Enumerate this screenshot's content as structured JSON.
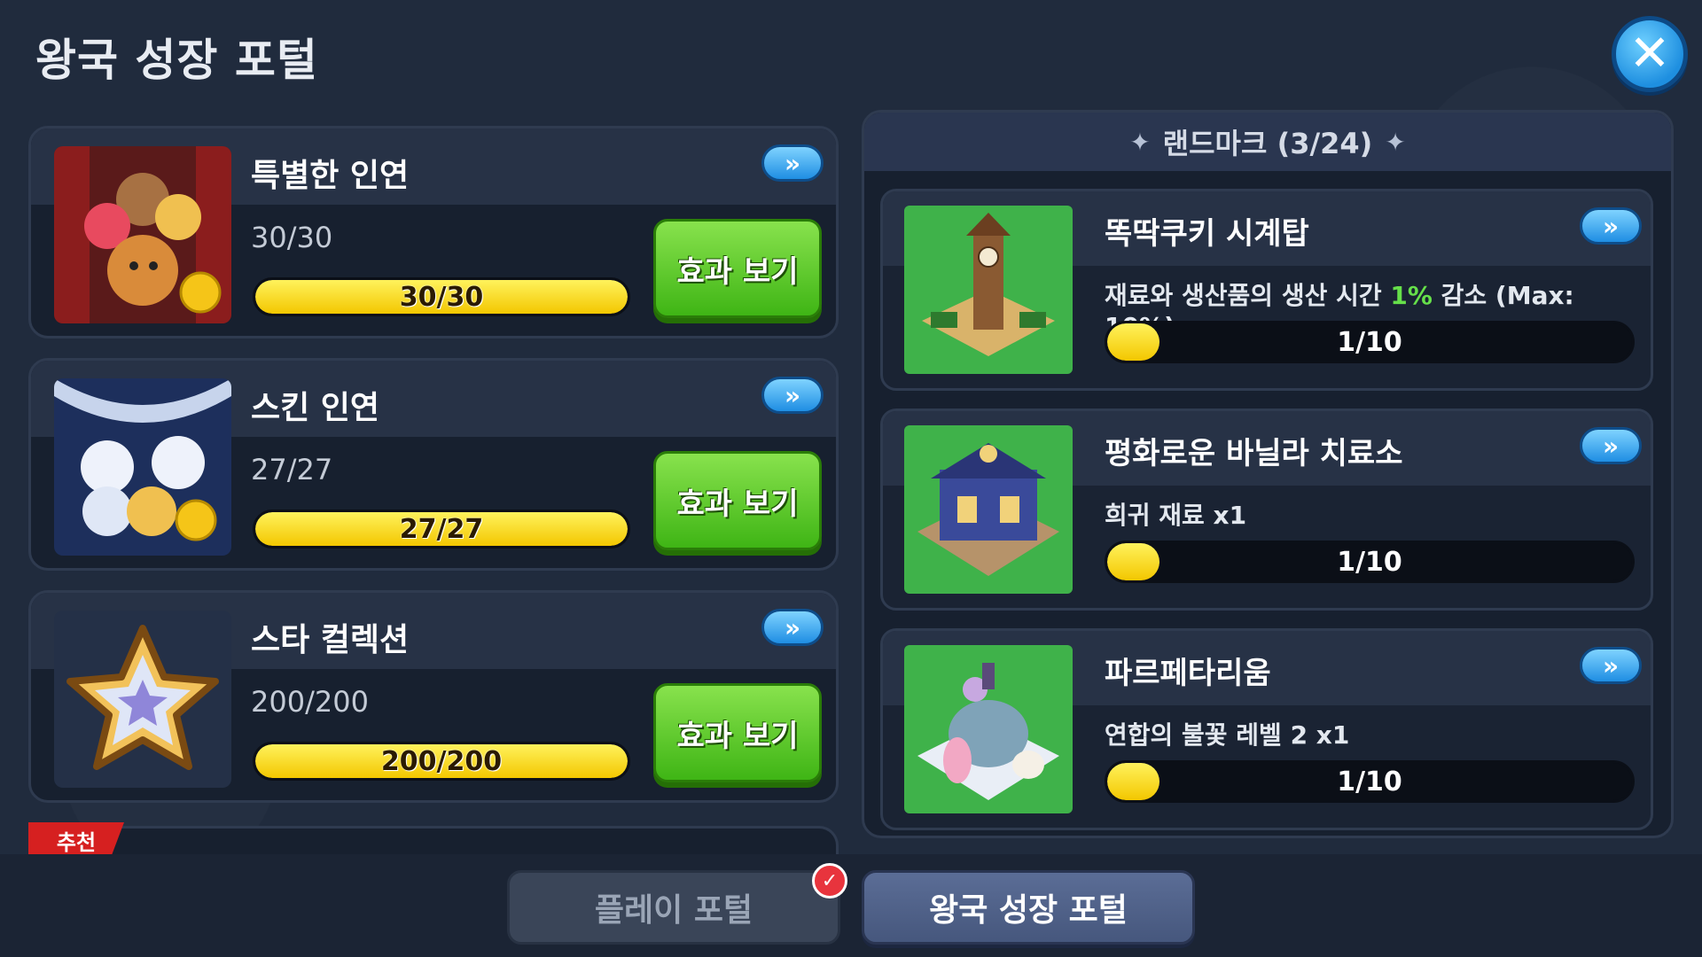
{
  "page_title": "왕국 성장 포털",
  "close_label": "✕",
  "cards": [
    {
      "title": "특별한 인연",
      "count": "30/30",
      "bar_label": "30/30",
      "progress": 1.0,
      "button": "효과 보기"
    },
    {
      "title": "스킨 인연",
      "count": "27/27",
      "bar_label": "27/27",
      "progress": 1.0,
      "button": "효과 보기"
    },
    {
      "title": "스타 컬렉션",
      "count": "200/200",
      "bar_label": "200/200",
      "progress": 1.0,
      "button": "효과 보기"
    }
  ],
  "recommend_badge": "추천",
  "landmarks": {
    "header": "랜드마크 (3/24)",
    "items": [
      {
        "title": "똑딱쿠키 시계탑",
        "desc_pre": "재료와 생산품의 생산 시간 ",
        "desc_hl": "1%",
        "desc_post": " 감소 (Max: 10%)",
        "bar_label": "1/10",
        "progress": 0.1
      },
      {
        "title": "평화로운 바닐라 치료소",
        "desc_pre": "희귀 재료 x1",
        "desc_hl": "",
        "desc_post": "",
        "bar_label": "1/10",
        "progress": 0.1
      },
      {
        "title": "파르페타리움",
        "desc_pre": "연합의 불꽃 레벨 2 x1",
        "desc_hl": "",
        "desc_post": "",
        "bar_label": "1/10",
        "progress": 0.1
      }
    ]
  },
  "tabs": {
    "play": "플레이 포털",
    "kingdom": "왕국 성장 포털"
  },
  "icons": {
    "close": "close-icon",
    "arrow": "double-chevron-right-icon",
    "check": "check-badge-icon",
    "star": "star-icon"
  },
  "colors": {
    "accent_green": "#4cc21e",
    "bar_yellow": "#f6d400",
    "highlight": "#66e04a",
    "close_blue": "#1e8fe0"
  }
}
